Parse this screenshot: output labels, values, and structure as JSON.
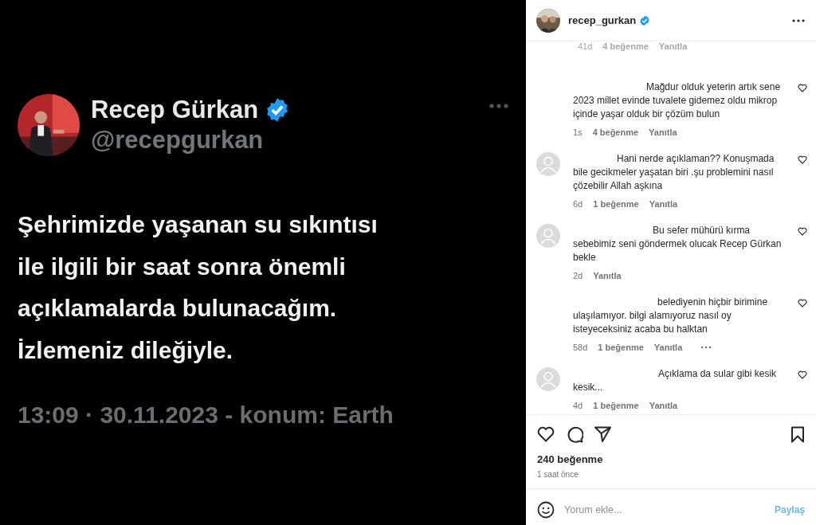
{
  "post_image": {
    "kind": "tweet",
    "author": {
      "name": "Recep Gürkan",
      "verified": true,
      "handle": "@recepgurkan"
    },
    "text": "Şehrimizde yaşanan su sıkıntısı\nile ilgili bir saat sonra önemli\naçıklamalarda bulunacağım.\nİzlemeniz dileğiyle.",
    "timestamp": "13:09 · 30.11.2023 - konum: Earth"
  },
  "post": {
    "username": "recep_gurkan",
    "verified": true,
    "comments": [
      {
        "kind": "cut",
        "avatar": false,
        "age": "41d",
        "likes": "4 beğenme",
        "reply": "Yanıtla"
      },
      {
        "kind": "full",
        "avatar": false,
        "text": "Mağdur olduk yeterin artık sene 2023 millet evinde tuvalete gidemez oldu mikrop içinde yaşar olduk bir çözüm bulun",
        "age": "1s",
        "likes": "4 beğenme",
        "reply": "Yanıtla"
      },
      {
        "kind": "full",
        "avatar": true,
        "text": "Hani nerde açıklaman?? Konuşmada bile gecikmeler yaşatan biri .şu problemini nasıl çözebilir Allah aşkına",
        "age": "6d",
        "likes": "1 beğenme",
        "reply": "Yanıtla"
      },
      {
        "kind": "full",
        "avatar": true,
        "text": "Bu sefer mühürü kırma sebebimiz seni göndermek olucak Recep Gürkan bekle",
        "age": "2d",
        "reply": "Yanıtla"
      },
      {
        "kind": "full",
        "avatar": false,
        "text": "belediyenin hiçbir birimine ulaşılamıyor. bilgi alamıyoruz nasıl oy isteyeceksiniz acaba bu halktan",
        "age": "58d",
        "likes": "1 beğenme",
        "reply": "Yanıtla",
        "more": true
      },
      {
        "kind": "full",
        "avatar": true,
        "text": "Açıklama da sular gibi kesik kesik...",
        "age": "4d",
        "likes": "1 beğenme",
        "reply": "Yanıtla"
      }
    ],
    "likes": "240 beğenme",
    "time": "1 saat önce",
    "comment_field": {
      "placeholder": "Yorum ekle...",
      "share": "Paylaş",
      "share_disabled": true
    }
  }
}
